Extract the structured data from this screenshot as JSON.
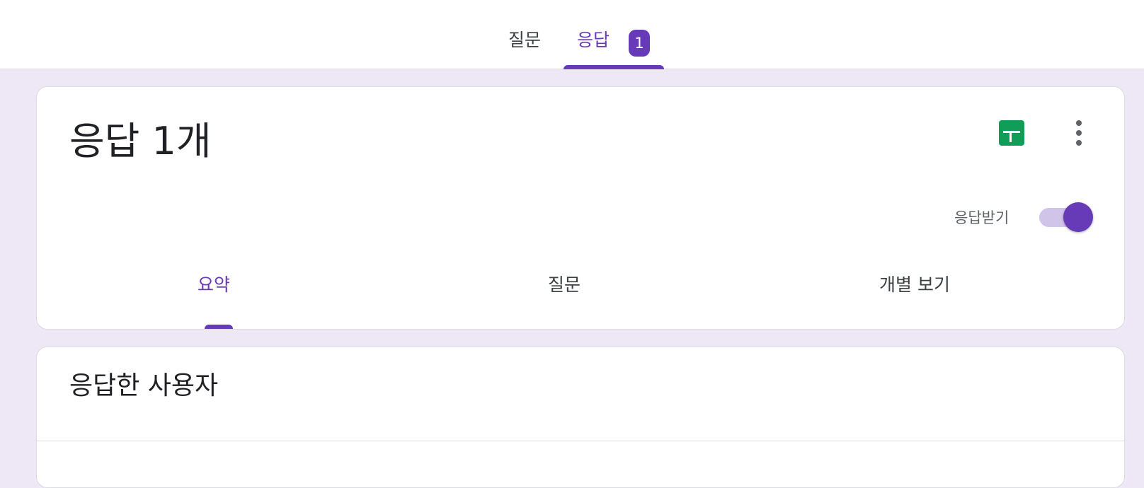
{
  "top_tabs": {
    "questions_label": "질문",
    "responses_label": "응답",
    "responses_badge": "1",
    "active": "responses"
  },
  "summary_card": {
    "title": "응답 1개",
    "sheets_icon": "google-sheets-icon",
    "more_icon": "more-vert-icon",
    "accepting_label": "응답받기",
    "accepting_responses": true,
    "sub_tabs": [
      {
        "label": "요약",
        "active": true
      },
      {
        "label": "질문",
        "active": false
      },
      {
        "label": "개별 보기",
        "active": false
      }
    ]
  },
  "respondents_card": {
    "title": "응답한 사용자"
  },
  "colors": {
    "accent": "#673ab7",
    "accent_light": "#d1c4e9",
    "page_background": "#ede7f6",
    "sheets_green": "#0f9d58"
  }
}
